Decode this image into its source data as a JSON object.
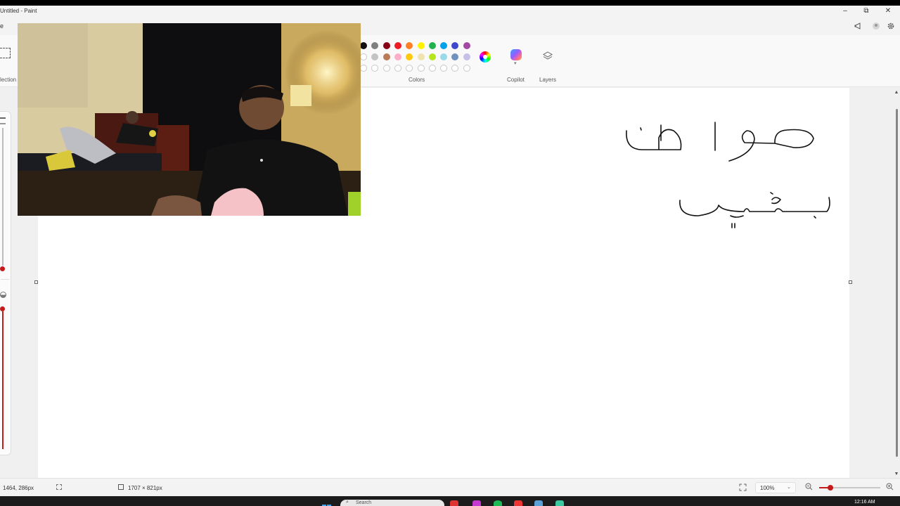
{
  "window": {
    "title": "Untitled - Paint",
    "minimize_glyph": "–",
    "maximize_glyph": "⧉",
    "close_glyph": "✕"
  },
  "menubar": {
    "partial_menu_label": "e",
    "right_icons": [
      "announcement-icon",
      "account-icon",
      "settings-icon"
    ]
  },
  "ribbon": {
    "selection_label": "lection",
    "colors_label": "Colors",
    "copilot_label": "Copilot",
    "layers_label": "Layers",
    "palette_row1": [
      "#111111",
      "#7f7f7f",
      "#880015",
      "#ed1c24",
      "#ff7f27",
      "#fff200",
      "#22b14c",
      "#00a2e8",
      "#3f48cc",
      "#a349a4"
    ],
    "palette_row2": [
      "#ffffff",
      "#c3c3c3",
      "#b97a57",
      "#ffaec9",
      "#ffc90e",
      "#efe4b0",
      "#b5e61d",
      "#99d9ea",
      "#7092be",
      "#c8bfe7"
    ],
    "palette_row3_empty_count": 10,
    "accent": "#c41a1a"
  },
  "canvas": {
    "handwriting_line1": "مواطن",
    "handwriting_line2": "بيضحي"
  },
  "status": {
    "cursor_position": "1464, 286px",
    "canvas_size": "1707 × 821px",
    "zoom": "100%",
    "zoom_slider_fraction": 0.18
  },
  "taskbar": {
    "search_placeholder": "Search",
    "clock": "12:16 AM"
  }
}
